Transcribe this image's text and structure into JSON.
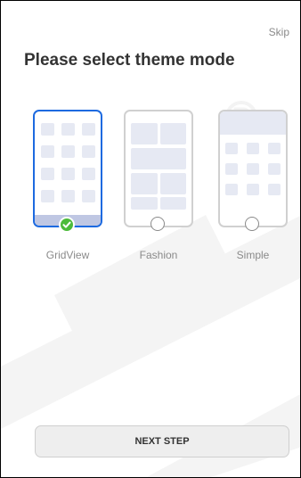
{
  "header": {
    "skip_label": "Skip",
    "title": "Please select theme mode"
  },
  "themes": [
    {
      "label": "GridView",
      "selected": true
    },
    {
      "label": "Fashion",
      "selected": false
    },
    {
      "label": "Simple",
      "selected": false
    }
  ],
  "footer": {
    "next_label": "NEXT STEP"
  },
  "colors": {
    "accent": "#1d6ae0",
    "check": "#4cbb3a",
    "placeholder_block": "#e6e9f3",
    "bottom_bar": "#bfc7e3"
  },
  "icons": {
    "selected": "check-circle-icon",
    "unselected": "radio-empty-icon"
  }
}
